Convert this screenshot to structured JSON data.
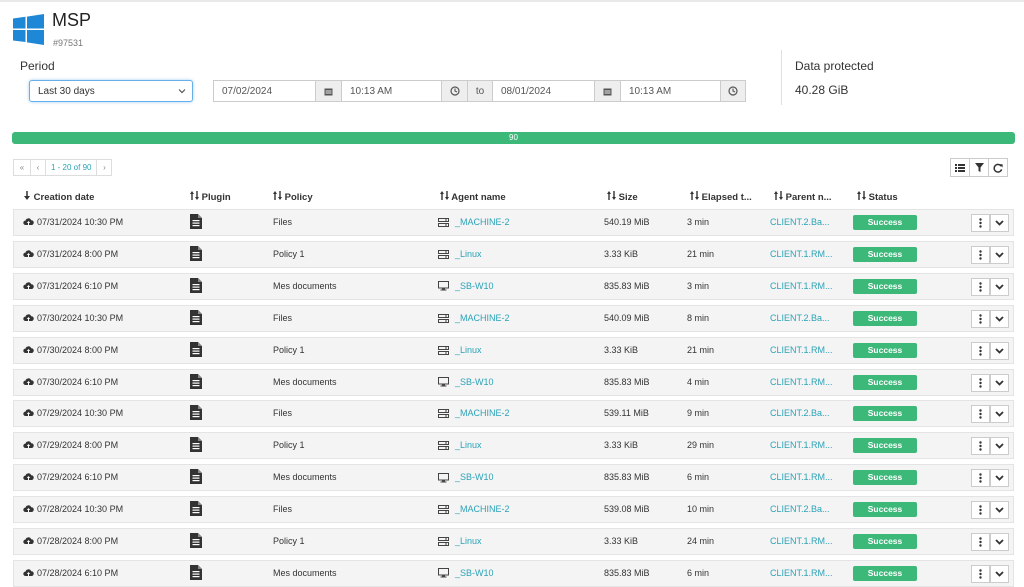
{
  "header": {
    "title": "MSP",
    "id": "#97531"
  },
  "period": {
    "label": "Period",
    "selected": "Last 30 days",
    "from_date": "07/02/2024",
    "from_time": "10:13 AM",
    "to_label": "to",
    "to_date": "08/01/2024",
    "to_time": "10:13 AM"
  },
  "data_protected": {
    "label": "Data protected",
    "value": "40.28 GiB"
  },
  "progress": {
    "label": "90",
    "fraction": 1.0
  },
  "pagination": {
    "first": "«",
    "prev": "‹",
    "info": "1 - 20 of 90",
    "next": "›"
  },
  "columns": {
    "creation_date": "Creation date",
    "plugin": "Plugin",
    "policy": "Policy",
    "agent_name": "Agent name",
    "size": "Size",
    "elapsed": "Elapsed t...",
    "parent": "Parent n...",
    "status": "Status"
  },
  "rows": [
    {
      "date": "07/31/2024 10:30 PM",
      "policy": "Files",
      "agent": "_MACHINE-2",
      "agent_icon": "server-icon",
      "size": "540.19 MiB",
      "elapsed": "3 min",
      "parent": "CLIENT.2.Ba...",
      "status": "Success"
    },
    {
      "date": "07/31/2024 8:00 PM",
      "policy": "Policy 1",
      "agent": "_Linux",
      "agent_icon": "server-icon",
      "size": "3.33 KiB",
      "elapsed": "21 min",
      "parent": "CLIENT.1.RM...",
      "status": "Success"
    },
    {
      "date": "07/31/2024 6:10 PM",
      "policy": "Mes documents",
      "agent": "_SB-W10",
      "agent_icon": "desktop-icon",
      "size": "835.83 MiB",
      "elapsed": "3 min",
      "parent": "CLIENT.1.RM...",
      "status": "Success"
    },
    {
      "date": "07/30/2024 10:30 PM",
      "policy": "Files",
      "agent": "_MACHINE-2",
      "agent_icon": "server-icon",
      "size": "540.09 MiB",
      "elapsed": "8 min",
      "parent": "CLIENT.2.Ba...",
      "status": "Success"
    },
    {
      "date": "07/30/2024 8:00 PM",
      "policy": "Policy 1",
      "agent": "_Linux",
      "agent_icon": "server-icon",
      "size": "3.33 KiB",
      "elapsed": "21 min",
      "parent": "CLIENT.1.RM...",
      "status": "Success"
    },
    {
      "date": "07/30/2024 6:10 PM",
      "policy": "Mes documents",
      "agent": "_SB-W10",
      "agent_icon": "desktop-icon",
      "size": "835.83 MiB",
      "elapsed": "4 min",
      "parent": "CLIENT.1.RM...",
      "status": "Success"
    },
    {
      "date": "07/29/2024 10:30 PM",
      "policy": "Files",
      "agent": "_MACHINE-2",
      "agent_icon": "server-icon",
      "size": "539.11 MiB",
      "elapsed": "9 min",
      "parent": "CLIENT.2.Ba...",
      "status": "Success"
    },
    {
      "date": "07/29/2024 8:00 PM",
      "policy": "Policy 1",
      "agent": "_Linux",
      "agent_icon": "server-icon",
      "size": "3.33 KiB",
      "elapsed": "29 min",
      "parent": "CLIENT.1.RM...",
      "status": "Success"
    },
    {
      "date": "07/29/2024 6:10 PM",
      "policy": "Mes documents",
      "agent": "_SB-W10",
      "agent_icon": "desktop-icon",
      "size": "835.83 MiB",
      "elapsed": "6 min",
      "parent": "CLIENT.1.RM...",
      "status": "Success"
    },
    {
      "date": "07/28/2024 10:30 PM",
      "policy": "Files",
      "agent": "_MACHINE-2",
      "agent_icon": "server-icon",
      "size": "539.08 MiB",
      "elapsed": "10 min",
      "parent": "CLIENT.2.Ba...",
      "status": "Success"
    },
    {
      "date": "07/28/2024 8:00 PM",
      "policy": "Policy 1",
      "agent": "_Linux",
      "agent_icon": "server-icon",
      "size": "3.33 KiB",
      "elapsed": "24 min",
      "parent": "CLIENT.1.RM...",
      "status": "Success"
    },
    {
      "date": "07/28/2024 6:10 PM",
      "policy": "Mes documents",
      "agent": "_SB-W10",
      "agent_icon": "desktop-icon",
      "size": "835.83 MiB",
      "elapsed": "6 min",
      "parent": "CLIENT.1.RM...",
      "status": "Success"
    }
  ],
  "colors": {
    "accent": "#2aa3b8",
    "success": "#3cb878",
    "focus": "#66afe9"
  }
}
